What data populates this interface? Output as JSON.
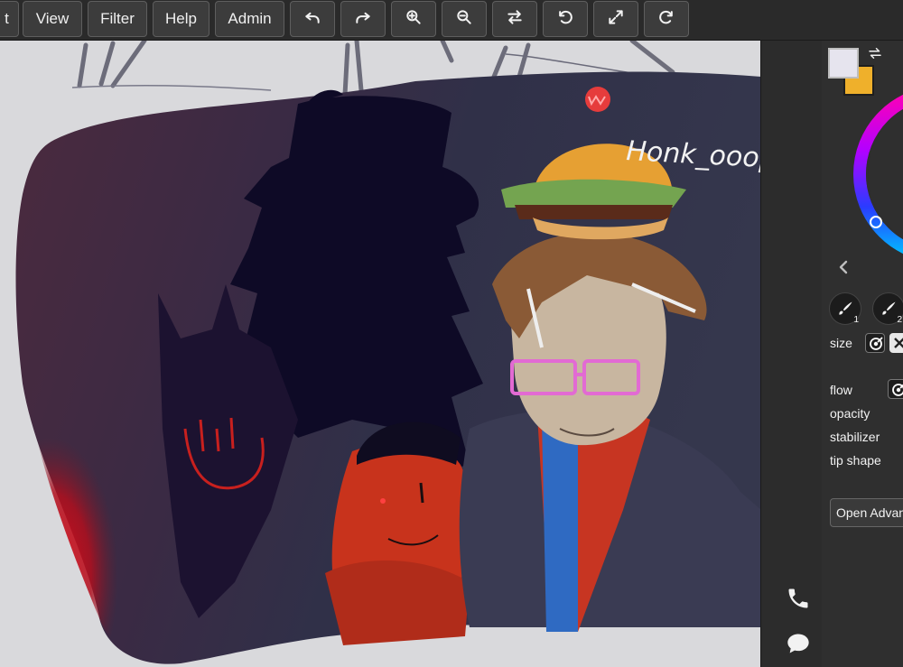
{
  "toolbar": {
    "menus": [
      {
        "name": "menu-edit",
        "label": "t"
      },
      {
        "name": "menu-view",
        "label": "View"
      },
      {
        "name": "menu-filter",
        "label": "Filter"
      },
      {
        "name": "menu-help",
        "label": "Help"
      },
      {
        "name": "menu-admin",
        "label": "Admin"
      }
    ],
    "tools": [
      {
        "name": "undo-button",
        "icon": "undo-icon"
      },
      {
        "name": "redo-button",
        "icon": "redo-icon"
      },
      {
        "name": "zoom-in-button",
        "icon": "zoom-in-icon"
      },
      {
        "name": "zoom-out-button",
        "icon": "zoom-out-icon"
      },
      {
        "name": "flip-view-button",
        "icon": "swap-horizontal-icon"
      },
      {
        "name": "rotate-left-button",
        "icon": "rotate-left-icon"
      },
      {
        "name": "fit-view-button",
        "icon": "expand-icon"
      },
      {
        "name": "rotate-right-button",
        "icon": "rotate-right-icon"
      }
    ]
  },
  "canvas": {
    "signature": "Honk_ooop"
  },
  "side_strip": {
    "icons": [
      "phone-icon",
      "chat-icon"
    ]
  },
  "panel": {
    "colors": {
      "primary": "#e6e4ee",
      "secondary": "#efb02b"
    },
    "brush_slots": [
      {
        "number": "1"
      },
      {
        "number": "2"
      }
    ],
    "labels": {
      "size": "size",
      "flow": "flow",
      "opacity": "opacity",
      "stabilizer": "stabilizer",
      "tip_shape": "tip shape"
    },
    "open_advanced_label": "Open Advanced"
  }
}
